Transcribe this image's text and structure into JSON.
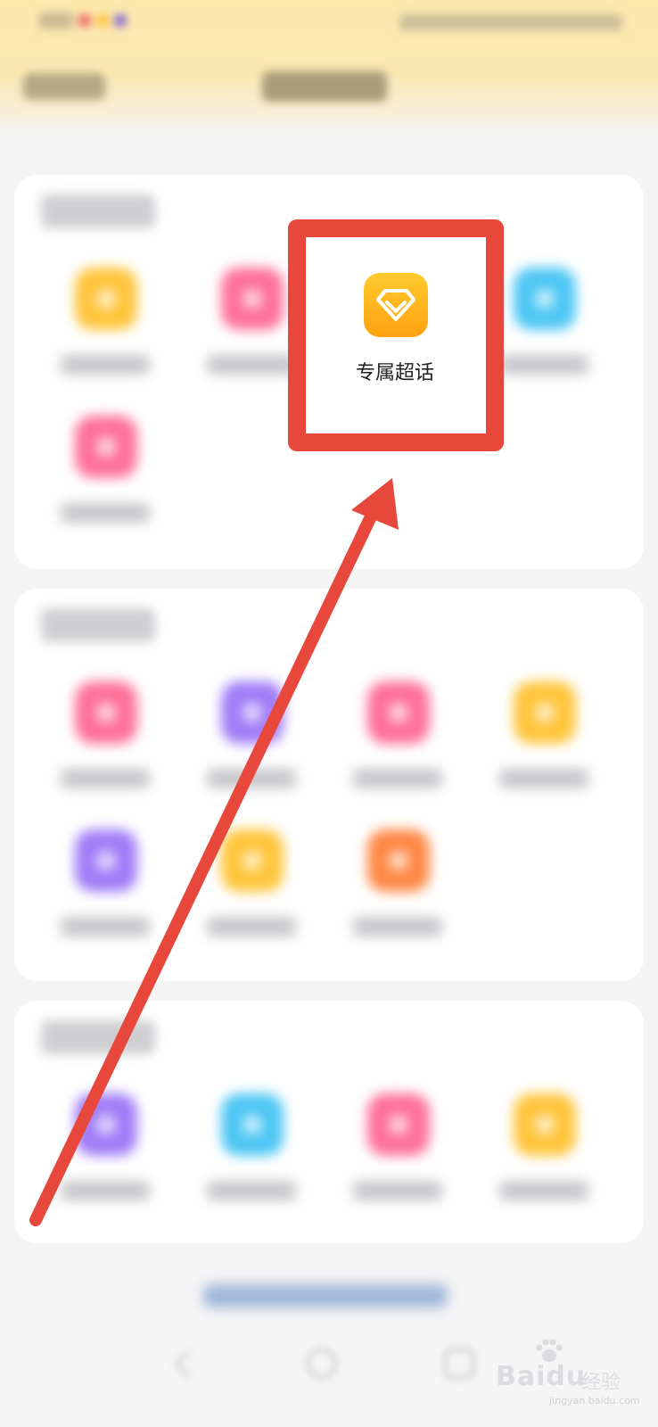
{
  "highlighted_feature": {
    "label": "专属超话",
    "icon": "diamond-icon"
  },
  "colors": {
    "annotation_red": "#e8473b",
    "feature_icon_gradient": [
      "#ffca2e",
      "#ffa20f"
    ],
    "header_gradient": [
      "#fde9ae",
      "#f8efd9"
    ],
    "blurred_icon_colors": {
      "yellow": "#ffc43a",
      "pink": "#ff6f9a",
      "blue": "#4cc6f4",
      "purple": "#a07bf7",
      "orange": "#ff8744"
    }
  },
  "watermark": {
    "brand": "Bai",
    "brand_suffix": "du",
    "sub": "经验",
    "url": "jingyan.baidu.com"
  }
}
